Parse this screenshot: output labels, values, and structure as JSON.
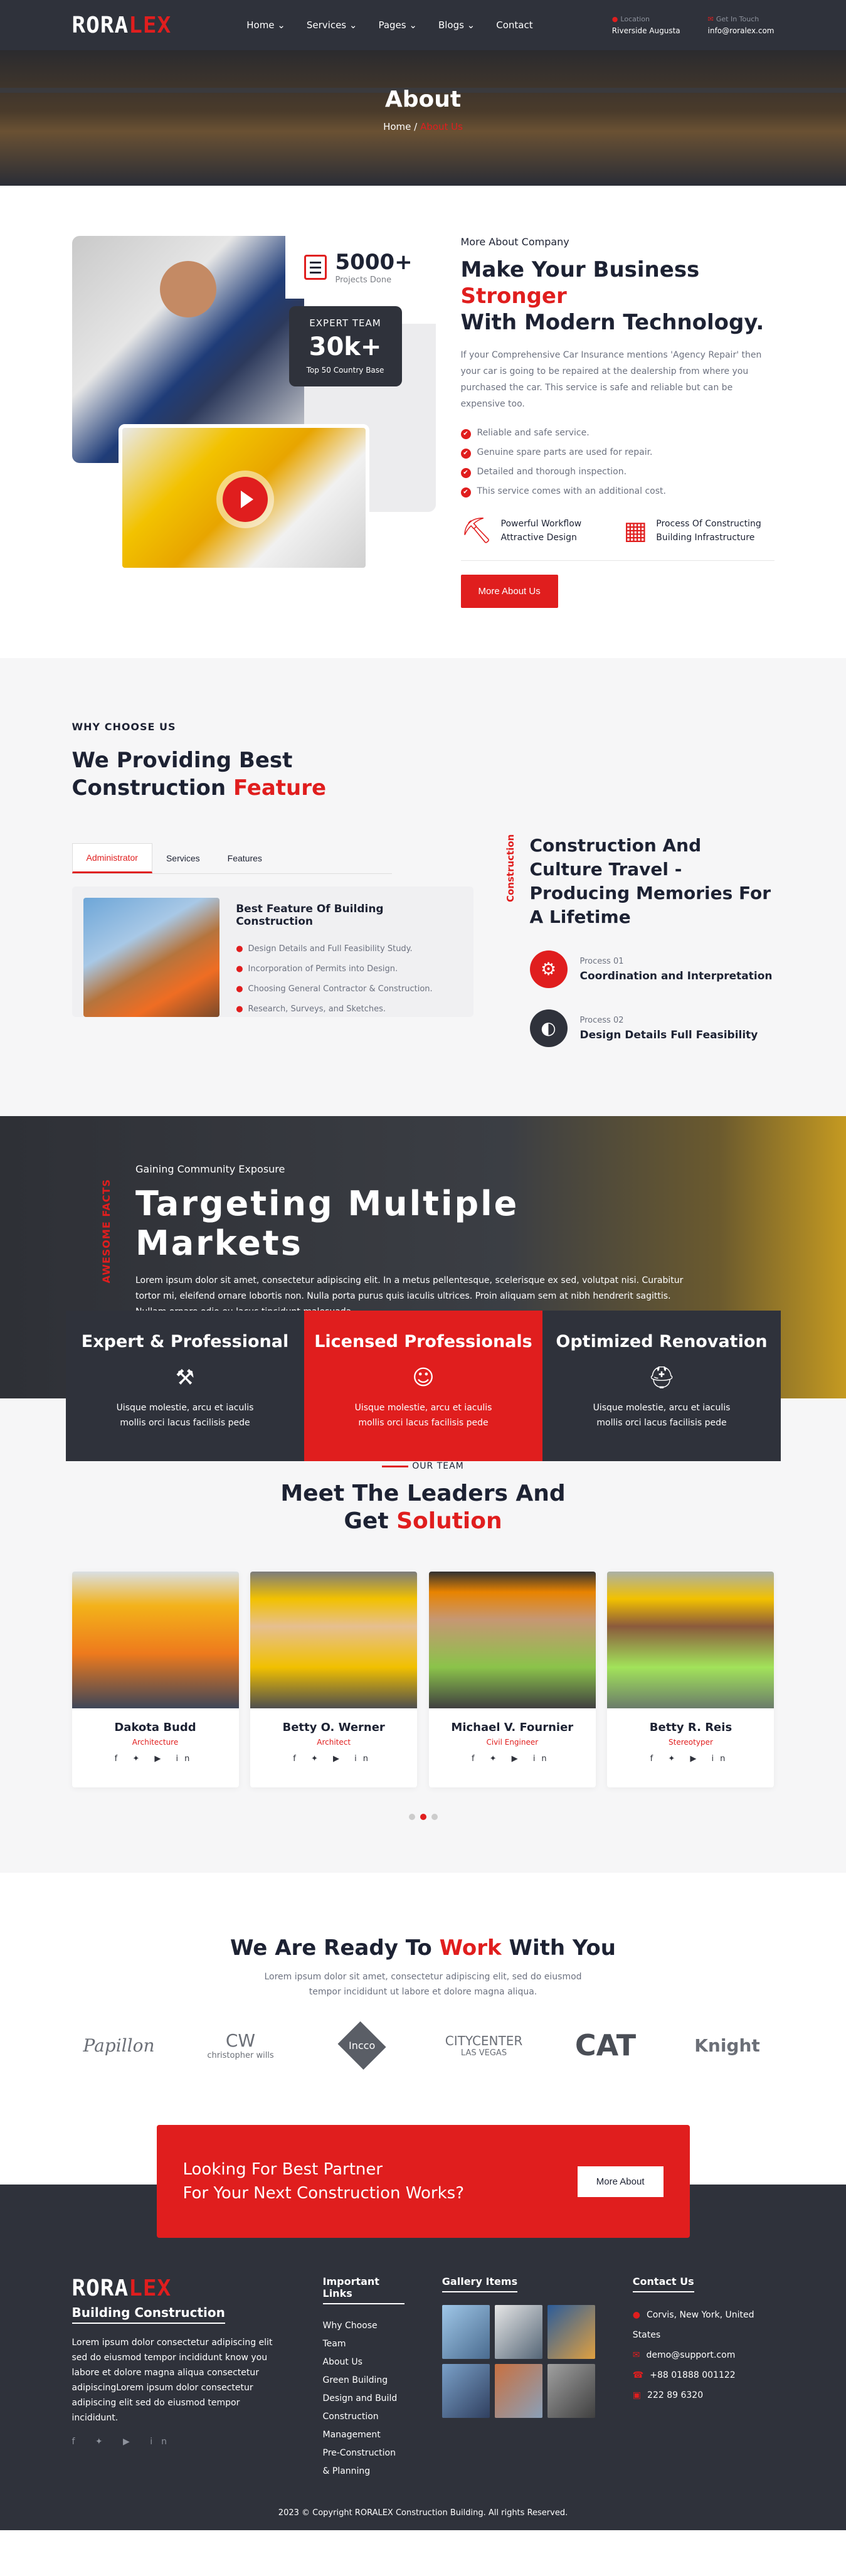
{
  "header": {
    "logo_a": "RORA",
    "logo_b": "LEX",
    "nav": [
      "Home ⌄",
      "Services ⌄",
      "Pages ⌄",
      "Blogs ⌄",
      "Contact"
    ],
    "location_label": "Location",
    "location": "Riverside Augusta",
    "touch_label": "Get In Touch",
    "email": "info@roralex.com"
  },
  "banner": {
    "title": "About",
    "home": "Home",
    "sep": "/",
    "current": "About Us"
  },
  "about": {
    "stat1_num": "5000+",
    "stat1_label": "Projects Done",
    "stat2_title": "EXPERT TEAM",
    "stat2_num": "30k+",
    "stat2_label": "Top 50 Country Base",
    "kicker": "More About Company",
    "h_a": "Make Your Business ",
    "h_b": "Stronger",
    "h_c": "With Modern Technology.",
    "para": "If your Comprehensive Car Insurance mentions 'Agency Repair' then your car is going to be repaired at the dealership from where you purchased the car. This service is safe and reliable but can be expensive too.",
    "checks": [
      "Reliable and safe service.",
      "Genuine spare parts are used for repair.",
      "Detailed and thorough inspection.",
      "This service comes with an additional cost."
    ],
    "feat1": "Powerful Workflow Attractive Design",
    "feat2": "Process Of Constructing Building Infrastructure",
    "button": "More About Us"
  },
  "why": {
    "tag": "WHY CHOOSE US",
    "h_a": "We Providing Best",
    "h_b": "Construction ",
    "h_c": "Feature",
    "tabs": [
      "Administrator",
      "Services",
      "Features"
    ],
    "card_title": "Best Feature Of Building Construction",
    "card_items": [
      "Design Details and Full Feasibility Study.",
      "Incorporation of Permits into Design.",
      "Choosing General Contractor & Construction.",
      "Research, Surveys, and Sketches."
    ],
    "vlabel": "Construction",
    "right_title": "Construction And Culture Travel - Producing Memories For A Lifetime",
    "p1_small": "Process 01",
    "p1_title": "Coordination and Interpretation",
    "p2_small": "Process 02",
    "p2_title": "Design Details Full Feasibility"
  },
  "markets": {
    "vlabel": "AWESOME FACTS",
    "sub": "Gaining Community Exposure",
    "title": "Targeting Multiple Markets",
    "para": "Lorem ipsum dolor sit amet, consectetur adipiscing elit. In a metus pellentesque, scelerisque ex sed, volutpat nisi. Curabitur tortor mi, eleifend ornare lobortis non. Nulla porta purus quis iaculis ultrices. Proin aliquam sem at nibh hendrerit sagittis. Nullam ornare odio eu lacus tincidunt malesuada.",
    "boxes": [
      {
        "title": "Expert & Professional",
        "text": "Uisque molestie, arcu et iaculis mollis orci lacus facilisis pede"
      },
      {
        "title": "Licensed Professionals",
        "text": "Uisque molestie, arcu et iaculis mollis orci lacus facilisis pede"
      },
      {
        "title": "Optimized Renovation",
        "text": "Uisque molestie, arcu et iaculis mollis orci lacus facilisis pede"
      }
    ]
  },
  "team": {
    "tag": "OUR TEAM",
    "h_a": "Meet The Leaders And",
    "h_b": "Get ",
    "h_c": "Solution",
    "members": [
      {
        "name": "Dakota Budd",
        "role": "Architecture"
      },
      {
        "name": "Betty O. Werner",
        "role": "Architect"
      },
      {
        "name": "Michael V. Fournier",
        "role": "Civil Engineer"
      },
      {
        "name": "Betty R. Reis",
        "role": "Stereotyper"
      }
    ]
  },
  "partners": {
    "h_a": "We Are Ready To ",
    "h_b": "Work",
    "h_c": " With You",
    "para": "Lorem ipsum dolor sit amet, consectetur adipiscing elit, sed do eiusmod tempor incididunt ut labore et dolore magna aliqua.",
    "logos": [
      "Papillon",
      "CW",
      "Incco",
      "CITYCENTER",
      "CAT",
      "Knight"
    ],
    "logo_subs": [
      "",
      "christopher wills",
      "",
      "LAS VEGAS",
      "",
      ""
    ]
  },
  "cta": {
    "line1": "Looking For Best Partner",
    "line2": "For Your Next Construction Works?",
    "button": "More About"
  },
  "footer": {
    "tagline": "Building Construction",
    "para": "Lorem ipsum dolor consectetur adipiscing elit sed do eiusmod tempor incididunt know you labore et dolore magna aliqua consectetur adipiscingLorem ipsum dolor consectetur adipiscing elit sed do eiusmod tempor incididunt.",
    "links_title": "Important Links",
    "links": [
      "Why Choose",
      "Team",
      "About Us",
      "Green Building",
      "Design and Build",
      "Construction Management",
      "Pre-Construction & Planning"
    ],
    "gallery_title": "Gallery Items",
    "contact_title": "Contact Us",
    "contact": [
      "Corvis, New York, United States",
      "demo@support.com",
      "+88 01888 001122",
      "222 89 6320"
    ],
    "copyright": "2023 © Copyright RORALEX Construction Building. All rights Reserved."
  }
}
